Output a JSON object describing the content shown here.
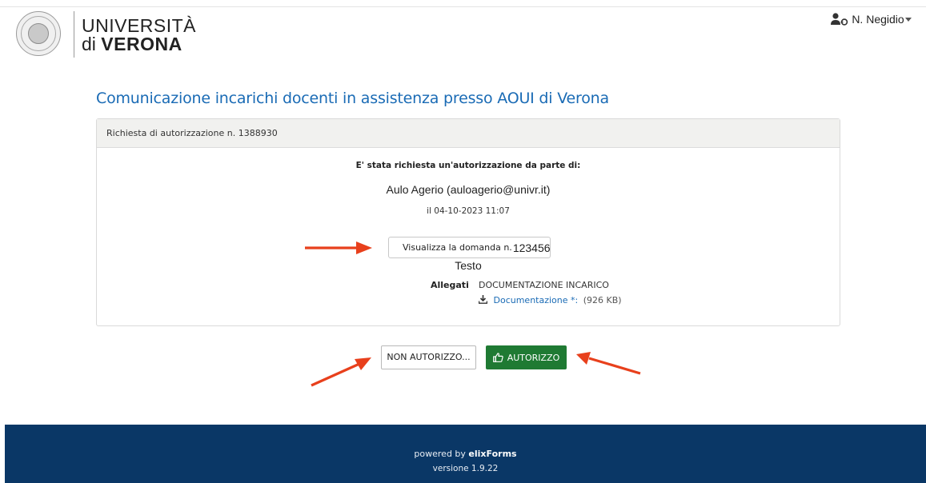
{
  "header": {
    "brand_line1": "UNIVERSITÀ",
    "brand_di": "di",
    "brand_name": "VERONA",
    "user_name": "N. Negidio",
    "user_icon": "user-shield-icon",
    "caret_icon": "caret-down-icon"
  },
  "page_title": "Comunicazione incarichi docenti in assistenza presso AOUI di Verona",
  "request": {
    "header": "Richiesta di autorizzazione n. 1388930",
    "requested_by_label": "E' stata richiesta un'autorizzazione da parte di:",
    "requester": "Aulo Agerio (auloagerio@univr.it)",
    "date": "il 04-10-2023 11:07",
    "view_button_label": "Visualizza la domanda n.",
    "view_button_number": "123456",
    "testo": "Testo",
    "attachments_label": "Allegati",
    "attachment_title": "DOCUMENTAZIONE INCARICO",
    "attachment_link": "Documentazione *:",
    "attachment_size": "(926 KB)"
  },
  "actions": {
    "deny_label": "NON AUTORIZZO...",
    "approve_label": "AUTORIZZO"
  },
  "footer": {
    "powered_by": "powered by",
    "product": "elixForms",
    "version": "versione 1.9.22"
  },
  "colors": {
    "title_blue": "#1a6bb5",
    "approve_green": "#1f7a33",
    "footer_navy": "#0a3766",
    "annotation_arrow": "#e8401c"
  }
}
